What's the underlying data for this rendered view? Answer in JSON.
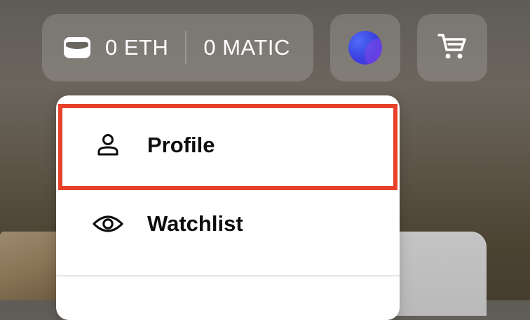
{
  "wallet": {
    "icon": "wallet-icon",
    "eth_balance": "0 ETH",
    "matic_balance": "0 MATIC"
  },
  "account_button": {
    "icon": "avatar"
  },
  "cart_button": {
    "icon": "cart-icon"
  },
  "menu": {
    "items": [
      {
        "label": "Profile",
        "icon": "person-icon"
      },
      {
        "label": "Watchlist",
        "icon": "eye-icon"
      }
    ]
  },
  "colors": {
    "highlight": "#e8412a",
    "avatar": "#3b3fe0"
  }
}
